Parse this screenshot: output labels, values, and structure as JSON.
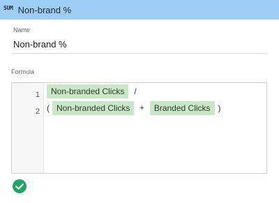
{
  "header": {
    "icon_text": "SUM",
    "title": "Non-brand %",
    "background": "#9dcdf4"
  },
  "name": {
    "label": "Name",
    "value": "Non-brand %"
  },
  "formula": {
    "label": "Formula",
    "line_numbers": [
      "1",
      "2"
    ],
    "line1": {
      "field": "Non-branded Clicks",
      "operator": "/"
    },
    "line2": {
      "open_paren": "(",
      "field_a": "Non-branded Clicks",
      "operator": "+",
      "field_b": "Branded Clicks",
      "close_paren": ")"
    },
    "chip_color": "#c9e8c7"
  },
  "status": {
    "icon": "check-circle-icon",
    "color": "#1fa462"
  }
}
